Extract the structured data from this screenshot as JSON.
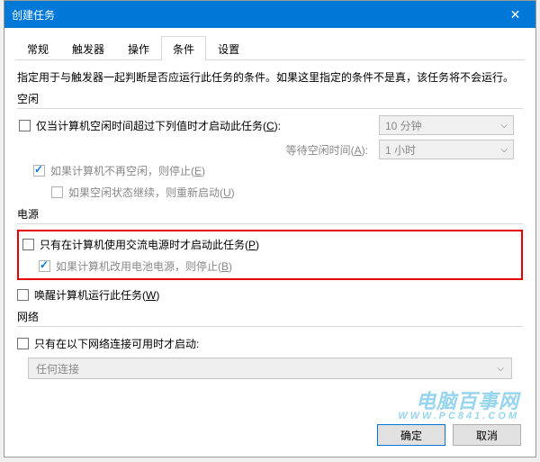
{
  "title": "创建任务",
  "close_glyph": "✕",
  "tabs": [
    "常规",
    "触发器",
    "操作",
    "条件",
    "设置"
  ],
  "active_tab_index": 3,
  "desc": "指定用于与触发器一起判断是否应运行此任务的条件。如果这里指定的条件不是真，该任务将不会运行。",
  "sections": {
    "idle": "空闲",
    "power": "电源",
    "network": "网络"
  },
  "rows": {
    "idle_start": {
      "pre": "仅当计算机空闲时间超过下列值时才启动此任务(",
      "u": "C",
      "post": "):"
    },
    "idle_wait": {
      "pre": "等待空闲时间(",
      "u": "A",
      "post": "):"
    },
    "idle_stop": {
      "pre": "如果计算机不再空闲，则停止(",
      "u": "E",
      "post": ")"
    },
    "idle_restart": {
      "pre": "如果空闲状态继续，则重新启动(",
      "u": "U",
      "post": ")"
    },
    "power_ac": {
      "pre": "只有在计算机使用交流电源时才启动此任务(",
      "u": "P",
      "post": ")"
    },
    "power_battery": {
      "pre": "如果计算机改用电池电源，则停止(",
      "u": "B",
      "post": ")"
    },
    "power_wake": {
      "pre": "唤醒计算机运行此任务(",
      "u": "W",
      "post": ")"
    },
    "network_start": {
      "text": "只有在以下网络连接可用时才启动:"
    }
  },
  "combos": {
    "idle_duration": "10 分钟",
    "idle_wait": "1 小时",
    "any_connection": "任何连接"
  },
  "buttons": {
    "ok": "确定",
    "cancel": "取消"
  },
  "watermark": {
    "line1": "电脑百事网",
    "line2": "WWW.PC841.COM"
  }
}
